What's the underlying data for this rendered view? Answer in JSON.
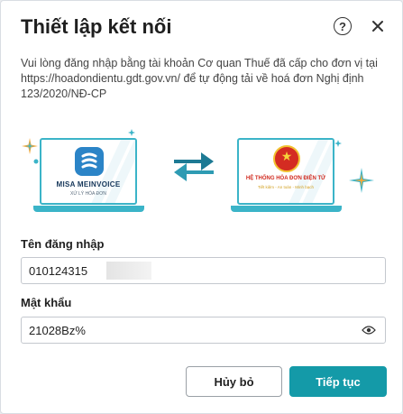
{
  "dialog": {
    "title": "Thiết lập kết nối",
    "help_icon": "question-circle-icon",
    "close_icon": "close-icon",
    "description_part1": "Vui lòng đăng nhập bằng tài khoản Cơ quan Thuế đã cấp cho đơn vị tại ",
    "description_link": "https://hoadondientu.gdt.gov.vn/",
    "description_part2": " để tự động tải về hoá đơn Nghị định 123/2020/NĐ-CP"
  },
  "illustration": {
    "left_logo_name": "MISA MEINVOICE",
    "left_logo_sub": "XỬ LÝ HÓA ĐƠN",
    "right_logo_name": "HỆ THỐNG HÓA ĐƠN ĐIỆN TỬ",
    "right_logo_sub": "Tiết kiệm   -   An toàn   -   Minh bạch",
    "accent_color": "#3bb4c8",
    "sync_icon": "sync-arrows-icon"
  },
  "form": {
    "username_label": "Tên đăng nhập",
    "username_value": "010124315",
    "password_label": "Mật khẩu",
    "password_value": "21028Bz%",
    "eye_icon": "eye-icon"
  },
  "actions": {
    "cancel_label": "Hủy bỏ",
    "next_label": "Tiếp tục",
    "primary_color": "#149aa8"
  }
}
